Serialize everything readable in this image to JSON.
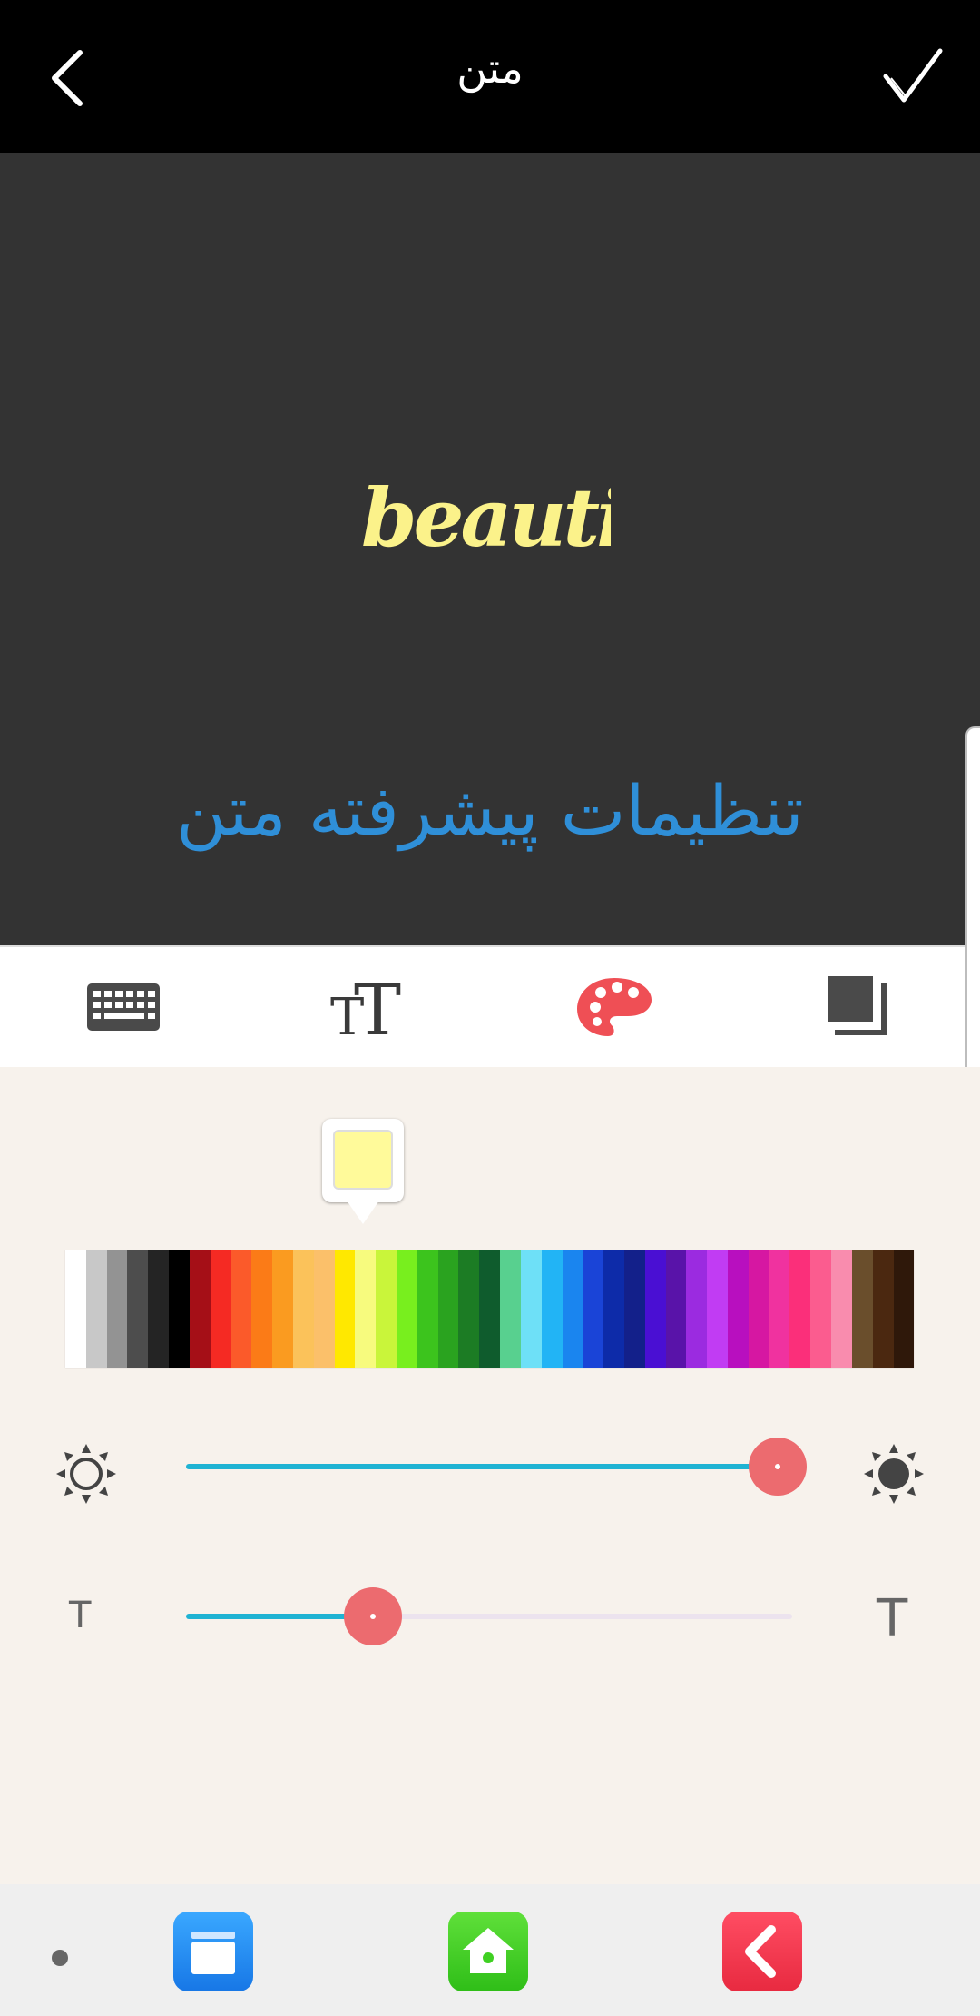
{
  "header": {
    "title": "متن"
  },
  "preview": {
    "sample_text": "beautiful",
    "advanced_settings_label": "تنظیمات پیشرفته متن"
  },
  "tabs": [
    {
      "icon": "keyboard-icon"
    },
    {
      "icon": "text-font-icon"
    },
    {
      "icon": "palette-icon",
      "active": true,
      "color": "#ef4f55"
    },
    {
      "icon": "shadow-icon"
    }
  ],
  "color": {
    "selected": "#fffa9a",
    "palette": [
      "#ffffff",
      "#c8c8c8",
      "#939393",
      "#4d4d4d",
      "#242424",
      "#000000",
      "#a50f17",
      "#f52a23",
      "#fb5a2a",
      "#fb7b17",
      "#fa9b20",
      "#fbc25a",
      "#fbc06a",
      "#ffe800",
      "#f7fb7e",
      "#c9f53a",
      "#78ef1e",
      "#3cc41d",
      "#2aa31f",
      "#1c7c24",
      "#0f5c2d",
      "#58d08f",
      "#6ee0f7",
      "#22b4f5",
      "#1a85ef",
      "#1a44d7",
      "#0d2ba9",
      "#13208a",
      "#4a0fd3",
      "#5913a9",
      "#9b2be0",
      "#c13cf3",
      "#b80fbf",
      "#d617a2",
      "#f0329f",
      "#fb2f7a",
      "#fb5c8f",
      "#f98cae",
      "#6a4e2c",
      "#4b2810",
      "#2f180a"
    ]
  },
  "sliders": {
    "brightness": {
      "value": 1.0,
      "left_icon": "brightness-low-icon",
      "right_icon": "brightness-high-icon"
    },
    "text_size": {
      "value": 0.31,
      "left_label": "T",
      "right_label": "T"
    }
  },
  "bottom_nav": [
    {
      "icon": "dot-icon"
    },
    {
      "icon": "stack-icon",
      "color": "#1e8ff0"
    },
    {
      "icon": "home-icon",
      "color": "#3fd022"
    },
    {
      "icon": "back-arrow-icon",
      "color": "#f3364f"
    }
  ],
  "accent": "#1fb3d3",
  "thumb_color": "#ec6b6f"
}
